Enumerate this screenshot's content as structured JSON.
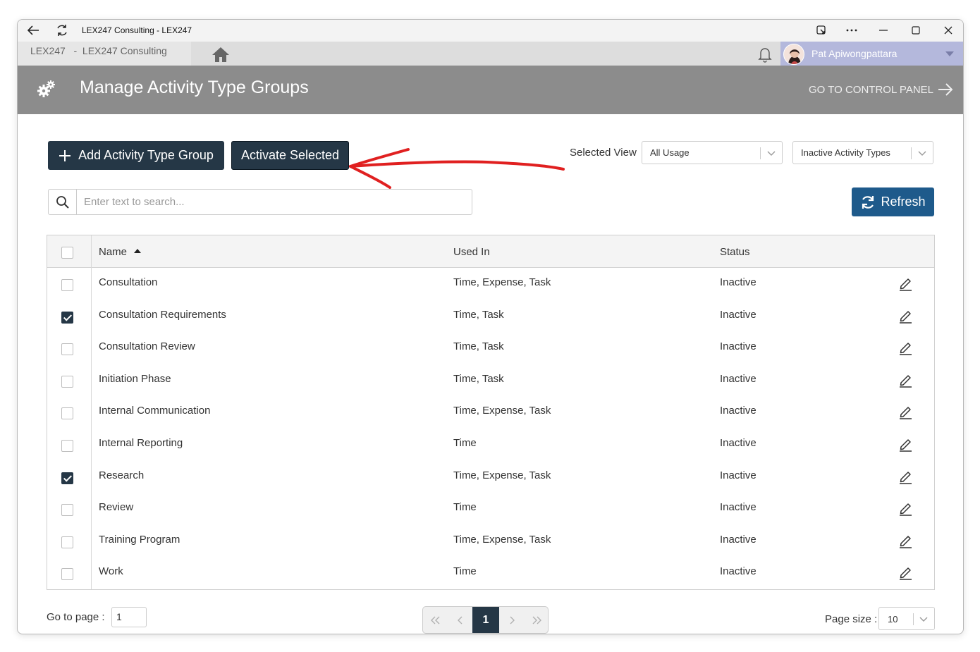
{
  "window": {
    "title": "LEX247 Consulting - LEX247"
  },
  "appbar": {
    "breadcrumb": "LEX247   -  LEX247 Consulting",
    "user_name": "Pat Apiwongpattara"
  },
  "header": {
    "title": "Manage Activity Type Groups",
    "control_panel_link": "GO TO CONTROL PANEL"
  },
  "toolbar": {
    "add_label": "Add Activity Type Group",
    "activate_label": "Activate Selected",
    "selected_view_label": "Selected View",
    "usage_value": "All Usage",
    "status_filter_value": "Inactive Activity Types",
    "refresh_label": "Refresh"
  },
  "search": {
    "placeholder": "Enter text to search..."
  },
  "table": {
    "columns": {
      "name": "Name",
      "used_in": "Used In",
      "status": "Status"
    },
    "rows": [
      {
        "name": "Consultation",
        "used_in": "Time, Expense, Task",
        "status": "Inactive",
        "checked": false
      },
      {
        "name": "Consultation Requirements",
        "used_in": "Time, Task",
        "status": "Inactive",
        "checked": true
      },
      {
        "name": "Consultation Review",
        "used_in": "Time, Task",
        "status": "Inactive",
        "checked": false
      },
      {
        "name": "Initiation Phase",
        "used_in": "Time, Task",
        "status": "Inactive",
        "checked": false
      },
      {
        "name": "Internal Communication",
        "used_in": "Time, Expense, Task",
        "status": "Inactive",
        "checked": false
      },
      {
        "name": "Internal Reporting",
        "used_in": "Time",
        "status": "Inactive",
        "checked": false
      },
      {
        "name": "Research",
        "used_in": "Time, Expense, Task",
        "status": "Inactive",
        "checked": true
      },
      {
        "name": "Review",
        "used_in": "Time",
        "status": "Inactive",
        "checked": false
      },
      {
        "name": "Training Program",
        "used_in": "Time, Expense, Task",
        "status": "Inactive",
        "checked": false
      },
      {
        "name": "Work",
        "used_in": "Time",
        "status": "Inactive",
        "checked": false
      }
    ]
  },
  "pager": {
    "goto_label": "Go to page :",
    "goto_value": "1",
    "current_page": "1",
    "page_size_label": "Page size :",
    "page_size_value": "10"
  }
}
